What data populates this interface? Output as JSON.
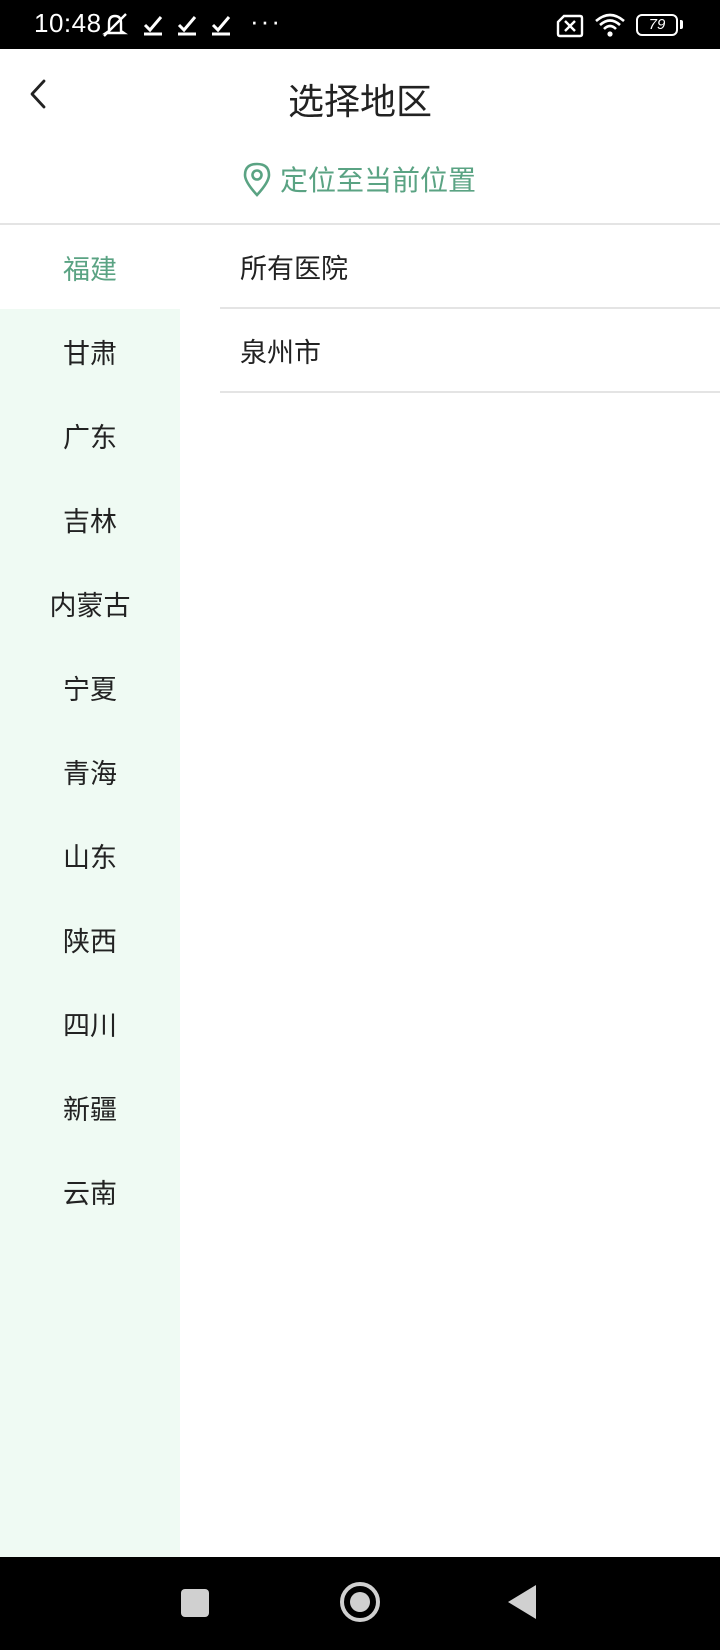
{
  "status_bar": {
    "time": "10:48",
    "dots": "···",
    "battery": "79",
    "icons": [
      "mute-icon",
      "check-icon",
      "check-icon",
      "check-icon",
      "no-sim-icon",
      "wifi-icon",
      "battery-icon"
    ]
  },
  "header": {
    "title": "选择地区",
    "back_icon": "chevron-left-icon"
  },
  "locate": {
    "label": "定位至当前位置",
    "icon": "location-pin-icon"
  },
  "provinces": [
    {
      "name": "福建",
      "selected": true
    },
    {
      "name": "甘肃",
      "selected": false
    },
    {
      "name": "广东",
      "selected": false
    },
    {
      "name": "吉林",
      "selected": false
    },
    {
      "name": "内蒙古",
      "selected": false
    },
    {
      "name": "宁夏",
      "selected": false
    },
    {
      "name": "青海",
      "selected": false
    },
    {
      "name": "山东",
      "selected": false
    },
    {
      "name": "陕西",
      "selected": false
    },
    {
      "name": "四川",
      "selected": false
    },
    {
      "name": "新疆",
      "selected": false
    },
    {
      "name": "云南",
      "selected": false
    }
  ],
  "cities": [
    {
      "name": "所有医院"
    },
    {
      "name": "泉州市"
    }
  ],
  "colors": {
    "accent": "#5aa383",
    "panel_bg": "#effaf3",
    "divider": "#e4e4e4"
  }
}
